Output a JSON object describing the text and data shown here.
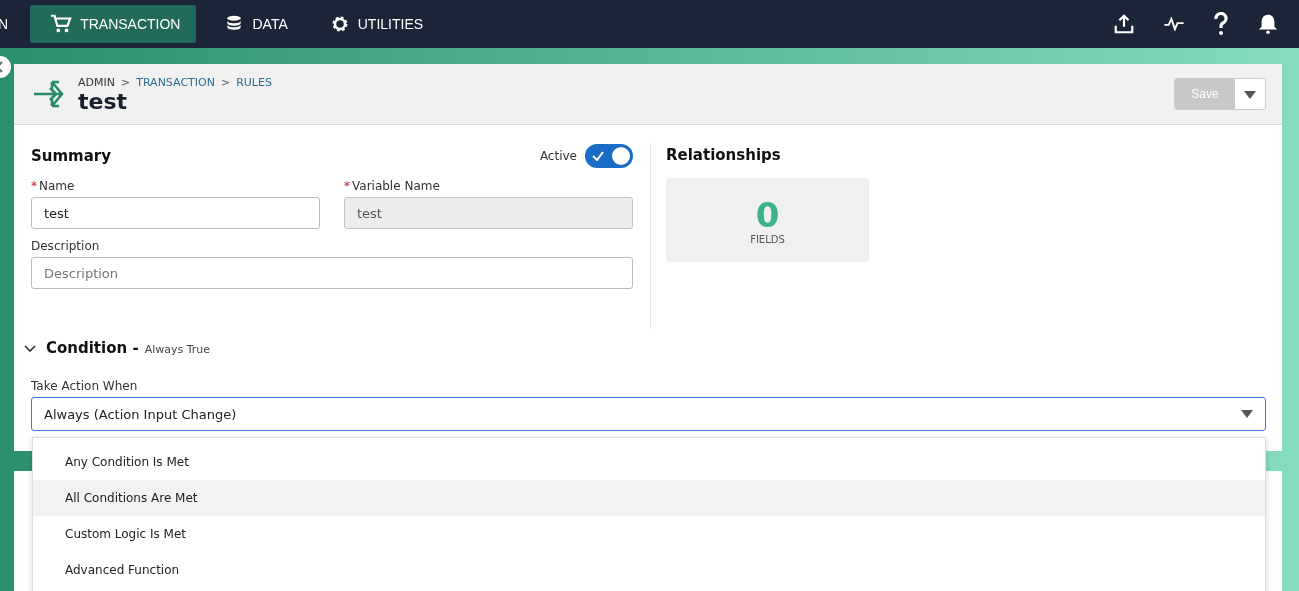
{
  "nav": {
    "tabs": [
      {
        "label": "N",
        "selected": false
      },
      {
        "label": "TRANSACTION",
        "selected": true
      },
      {
        "label": "DATA",
        "selected": false
      },
      {
        "label": "UTILITIES",
        "selected": false
      }
    ]
  },
  "header": {
    "breadcrumb": [
      {
        "label": "ADMIN",
        "link": false
      },
      {
        "separator": ">",
        "label": "TRANSACTION",
        "link": true
      },
      {
        "separator": ">",
        "label": "RULES",
        "link": true
      }
    ],
    "title": "test",
    "save": {
      "label": "Save",
      "disabled": true
    }
  },
  "summary": {
    "title": "Summary",
    "active": {
      "label": "Active",
      "on": true
    },
    "fields": [
      {
        "label": "Name",
        "required_mark": "*",
        "value": "test",
        "disabled": false
      },
      {
        "label": "Variable Name",
        "required_mark": "*",
        "value": "test",
        "disabled": true
      }
    ],
    "description": {
      "label": "Description",
      "placeholder": "Description"
    }
  },
  "relationships": {
    "title": "Relationships",
    "count": "0",
    "unit": "FIELDS"
  },
  "condition": {
    "title": "Condition -",
    "subtitle": "Always True",
    "expanded": true,
    "field_label": "Take Action When",
    "value": "Always (Action Input Change)",
    "options": [
      {
        "label": "Any Condition Is Met",
        "selected": false
      },
      {
        "label": "All Conditions Are Met",
        "selected": true
      },
      {
        "label": "Custom Logic Is Met",
        "selected": false
      },
      {
        "label": "Advanced Function",
        "selected": false
      }
    ]
  }
}
